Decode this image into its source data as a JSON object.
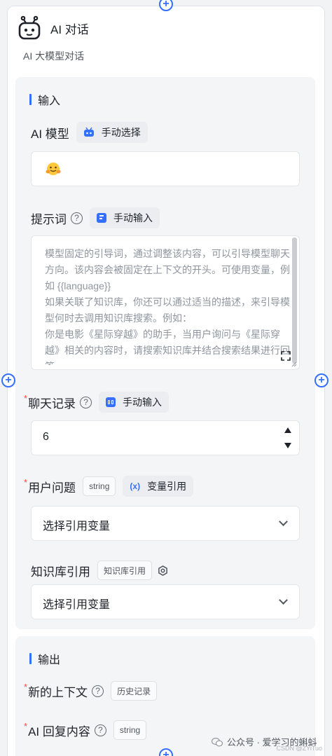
{
  "node": {
    "title": "AI 对话",
    "description": "AI 大模型对话",
    "icon": "robot-icon"
  },
  "input_section": {
    "title": "输入",
    "ai_model": {
      "label": "AI 模型",
      "chip_label": "手动选择",
      "chip_icon": "robot-small-icon",
      "value_icon": "hugging-face-emoji"
    },
    "prompt": {
      "label": "提示词",
      "chip_label": "手动输入",
      "chip_icon": "text-input-icon",
      "placeholder": "模型固定的引导词，通过调整该内容，可以引导模型聊天方向。该内容会被固定在上下文的开头。可使用变量，例如 {{language}}\n如果关联了知识库，你还可以通过适当的描述，来引导模型何时去调用知识库搜索。例如：\n你是电影《星际穿越》的助手，当用户询问与《星际穿越》相关的内容时，请搜索知识库并结合搜索结果进行回答。",
      "expand_icon": "expand-icon"
    },
    "chat_history": {
      "label": "聊天记录",
      "required": "*",
      "chip_label": "手动输入",
      "chip_icon": "number-input-icon",
      "value": "6"
    },
    "user_question": {
      "label": "用户问题",
      "required": "*",
      "type_tag": "string",
      "chip_label": "变量引用",
      "chip_icon": "variable-icon",
      "select_placeholder": "选择引用变量"
    },
    "knowledge_ref": {
      "label": "知识库引用",
      "type_tag": "知识库引用",
      "settings_icon": "gear-icon",
      "select_placeholder": "选择引用变量"
    }
  },
  "output_section": {
    "title": "输出",
    "new_context": {
      "label": "新的上下文",
      "required": "*",
      "type_tag": "历史记录"
    },
    "ai_reply": {
      "label": "AI 回复内容",
      "required": "*",
      "type_tag": "string"
    }
  },
  "watermark": {
    "text": "公众号 · 爱学习的蝌蚪",
    "sub": "CSDN @ZYiTuo"
  },
  "colors": {
    "accent": "#3370ff",
    "required": "#f54a45",
    "card_bg": "#ffffff",
    "section_bg": "#f4f5f7"
  }
}
